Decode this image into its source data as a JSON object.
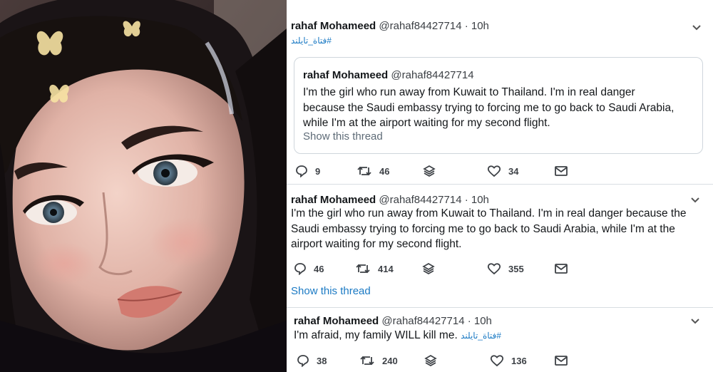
{
  "photo": {
    "description_icon": "portrait-photo"
  },
  "tweets": [
    {
      "name": "rahaf Mohameed",
      "handle": "@rahaf84427714",
      "dot": "·",
      "time": "10h",
      "hashtag": "#فتاة_تايلند",
      "quote": {
        "name": "rahaf Mohameed",
        "handle": "@rahaf84427714",
        "lines": [
          "I'm the girl who run away from Kuwait to Thailand. I'm in real danger",
          "because the Saudi embassy trying to forcing me to go back to Saudi Arabia,",
          "while I'm at the airport waiting for my second flight."
        ],
        "show_thread": "Show this thread"
      },
      "replies": "9",
      "retweets": "46",
      "likes": "34"
    },
    {
      "name": "rahaf Mohameed",
      "handle": "@rahaf84427714",
      "dot": "·",
      "time": "10h",
      "lines": [
        "I'm the girl who run away from Kuwait to Thailand. I'm in real danger because the",
        "Saudi embassy trying to forcing me to go back to Saudi Arabia, while I'm at the",
        "airport waiting for my second flight."
      ],
      "replies": "46",
      "retweets": "414",
      "likes": "355",
      "show_thread": "Show this thread"
    },
    {
      "name": "rahaf Mohameed",
      "handle": "@rahaf84427714",
      "dot": "·",
      "time": "10h",
      "text": "I'm afraid, my family WILL kill me.",
      "hashtag": "#فتاة_تايلند",
      "replies": "38",
      "retweets": "240",
      "likes": "136"
    }
  ]
}
